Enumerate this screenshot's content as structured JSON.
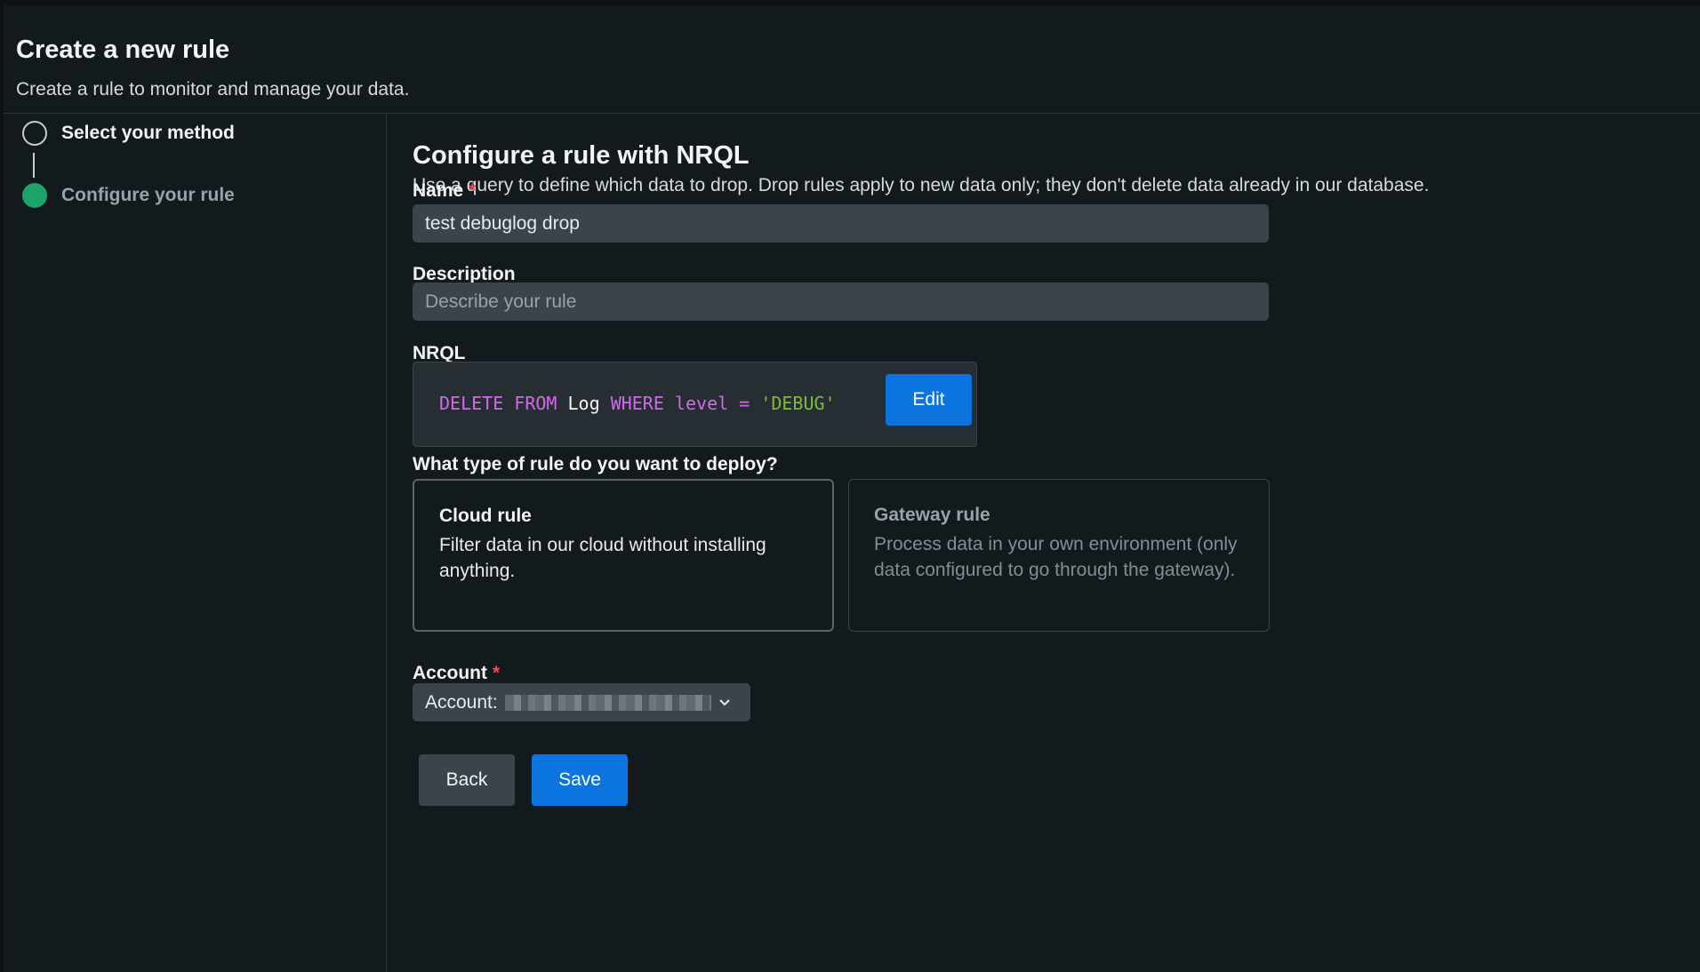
{
  "header": {
    "title": "Create a new rule",
    "subtitle": "Create a rule to monitor and manage your data."
  },
  "steps": [
    {
      "label": "Select your method",
      "state": "completed"
    },
    {
      "label": "Configure your rule",
      "state": "current"
    }
  ],
  "main": {
    "title": "Configure a rule with NRQL",
    "description": "Use a query to define which data to drop. Drop rules apply to new data only; they don't delete data already in our database.",
    "name_field": {
      "label": "Name",
      "required_mark": "*",
      "value": "test debuglog drop"
    },
    "description_field": {
      "label": "Description",
      "placeholder": "Describe your rule"
    },
    "nrql": {
      "label": "NRQL",
      "tokens": {
        "delete": "DELETE",
        "from": "FROM",
        "table": "Log",
        "where": "WHERE",
        "field": "level",
        "op": "=",
        "value": "'DEBUG'"
      },
      "copy_icon": "clipboard-icon",
      "edit_label": "Edit"
    },
    "rule_type": {
      "question": "What type of rule do you want to deploy?",
      "options": [
        {
          "title": "Cloud rule",
          "description": "Filter data in our cloud without installing anything.",
          "selected": true
        },
        {
          "title": "Gateway rule",
          "description": "Process data in your own environment (only data configured to go through the gateway).",
          "selected": false
        }
      ]
    },
    "account": {
      "label": "Account",
      "required_mark": "*",
      "prefix": "Account:",
      "chevron_icon": "chevron-down-icon"
    },
    "actions": {
      "back_label": "Back",
      "save_label": "Save"
    }
  },
  "colors": {
    "background": "#131a1e",
    "primary_button": "#0c74df",
    "step_active": "#1ca36a",
    "required": "#ee4b4b",
    "nrql_keyword": "#d26ae8",
    "nrql_string": "#7ebd3a"
  }
}
